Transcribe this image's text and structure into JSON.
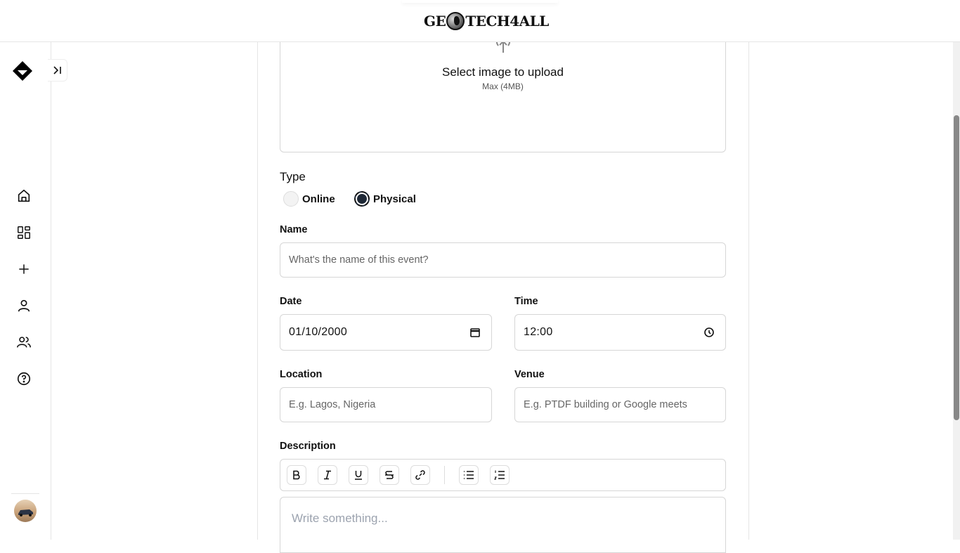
{
  "header": {
    "logo_left": "GE",
    "logo_right": "TECH4ALL"
  },
  "sidebar": {
    "items": [
      {
        "name": "home",
        "icon": "home-icon"
      },
      {
        "name": "dashboard",
        "icon": "dashboard-icon"
      },
      {
        "name": "create",
        "icon": "plus-icon"
      },
      {
        "name": "profile",
        "icon": "user-icon"
      },
      {
        "name": "community",
        "icon": "users-icon"
      },
      {
        "name": "help",
        "icon": "help-icon"
      }
    ],
    "collapse_icon": "expand-sidebar-icon"
  },
  "upload": {
    "title": "Select image to upload",
    "subtitle": "Max (4MB)"
  },
  "form": {
    "type_label": "Type",
    "type_options": [
      {
        "label": "Online",
        "selected": false
      },
      {
        "label": "Physical",
        "selected": true
      }
    ],
    "name_label": "Name",
    "name_placeholder": "What's the name of this event?",
    "date_label": "Date",
    "date_value": "01/10/2000",
    "time_label": "Time",
    "time_value": "12:00",
    "location_label": "Location",
    "location_placeholder": "E.g. Lagos, Nigeria",
    "venue_label": "Venue",
    "venue_placeholder": "E.g. PTDF building or Google meets",
    "description_label": "Description",
    "description_placeholder": "Write something...",
    "toolbar": [
      "bold",
      "italic",
      "underline",
      "strikethrough",
      "link",
      "bullet-list",
      "ordered-list"
    ]
  }
}
